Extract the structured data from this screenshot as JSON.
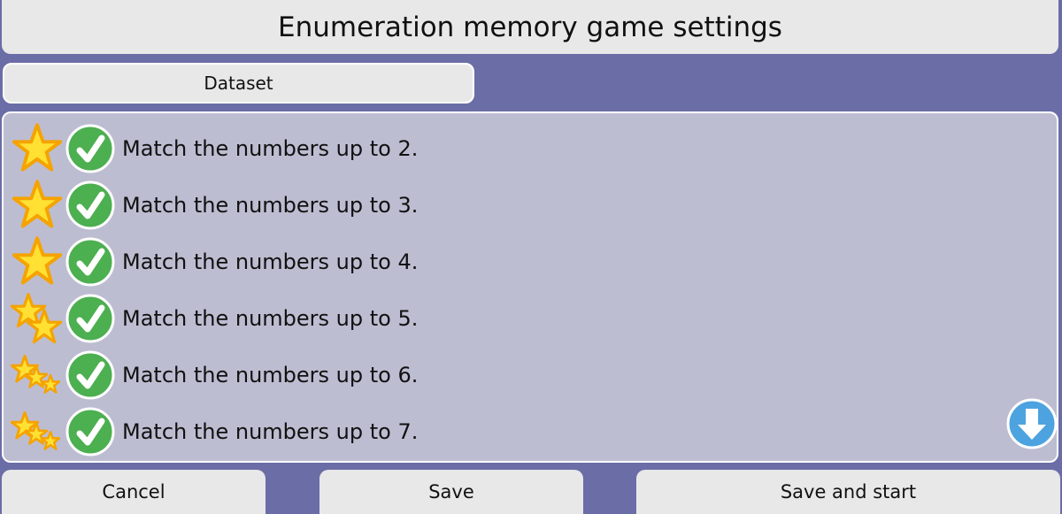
{
  "header": {
    "title": "Enumeration memory game settings"
  },
  "tabs": [
    {
      "label": "Dataset"
    }
  ],
  "datasets": [
    {
      "label": "Match the numbers up to 2.",
      "stars": 1,
      "selected": true
    },
    {
      "label": "Match the numbers up to 3.",
      "stars": 1,
      "selected": true
    },
    {
      "label": "Match the numbers up to 4.",
      "stars": 1,
      "selected": true
    },
    {
      "label": "Match the numbers up to 5.",
      "stars": 2,
      "selected": true
    },
    {
      "label": "Match the numbers up to 6.",
      "stars": 3,
      "selected": true
    },
    {
      "label": "Match the numbers up to 7.",
      "stars": 3,
      "selected": true
    }
  ],
  "footer": {
    "cancel_label": "Cancel",
    "save_label": "Save",
    "save_start_label": "Save and start"
  },
  "colors": {
    "background": "#6b6da6",
    "panel": "#bdbdd2",
    "button": "#e8e8e8",
    "check": "#4caf50",
    "star_fill": "#ffe033",
    "star_stroke": "#f5a300",
    "scroll": "#4da3e0"
  },
  "icons": {
    "difficulty": "star-icon",
    "selected": "check-icon",
    "scroll": "arrow-down-icon"
  }
}
